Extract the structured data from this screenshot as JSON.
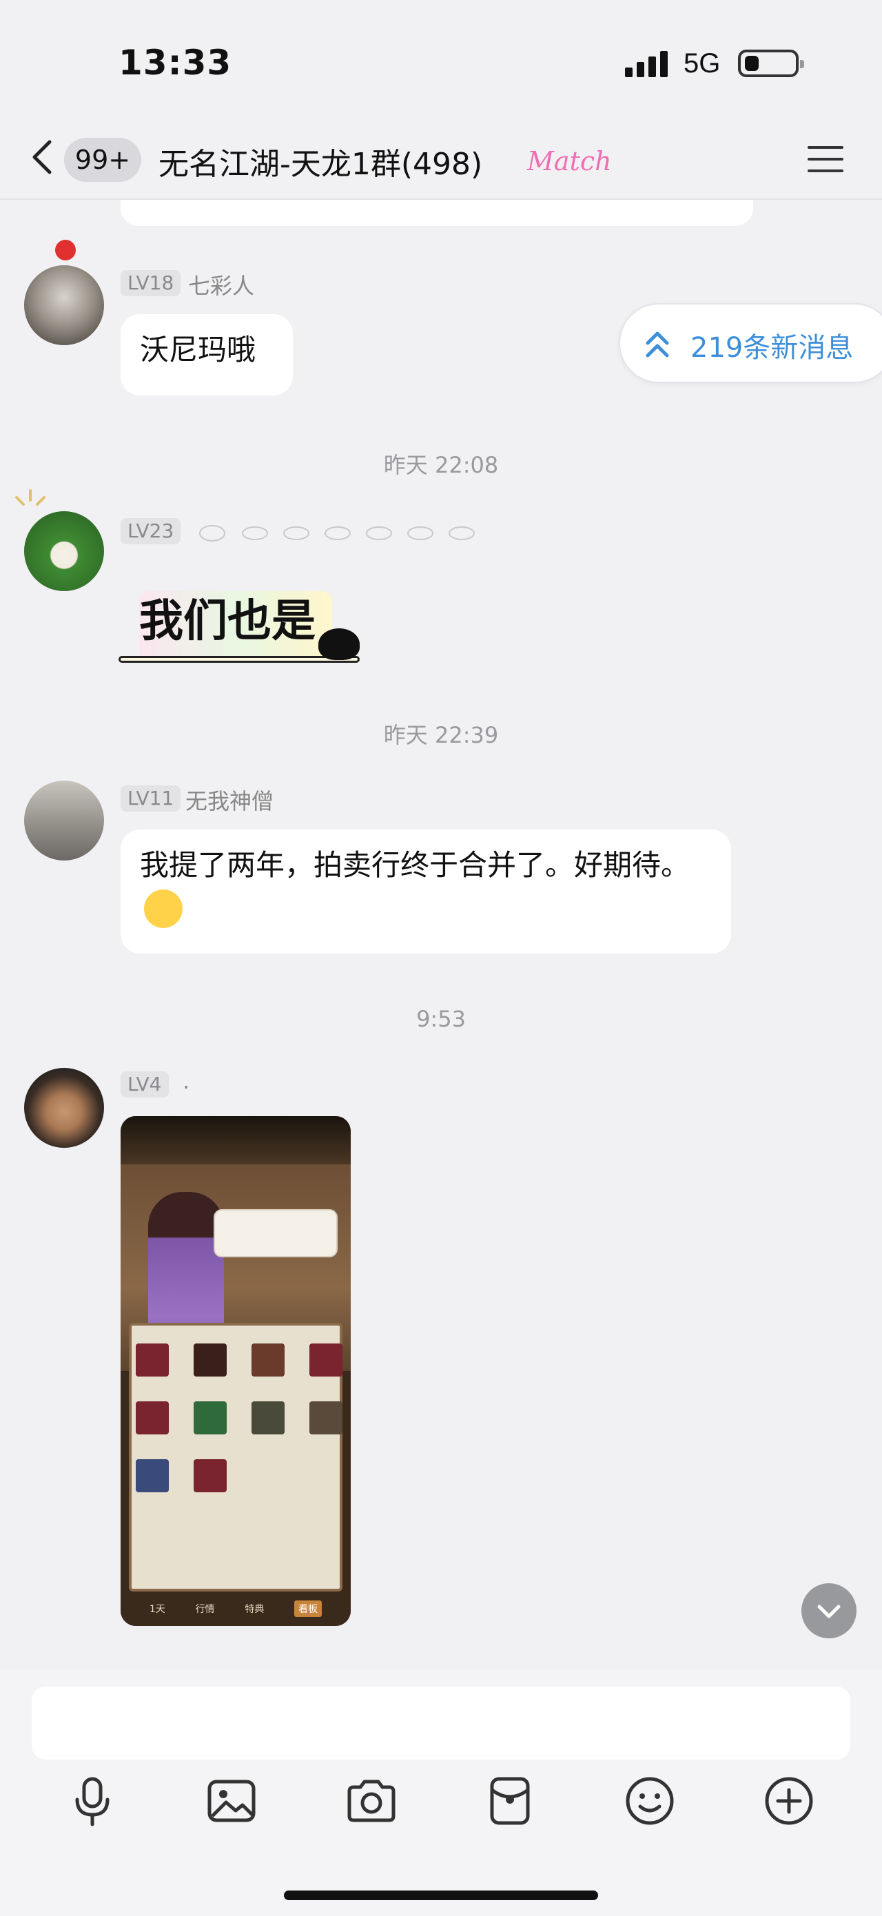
{
  "status_bar": {
    "time": "13:33",
    "network": "5G"
  },
  "header": {
    "unread_badge": "99+",
    "title": "无名江湖-天龙1群(498)",
    "title_tag": "Match"
  },
  "new_messages": {
    "label": "219条新消息"
  },
  "messages": [
    {
      "level": "LV18",
      "nickname": "七彩人",
      "text": "沃尼玛哦"
    },
    {
      "timestamp": "昨天 22:08"
    },
    {
      "level": "LV23",
      "nickname": "",
      "sticker_text": "我们也是"
    },
    {
      "timestamp": "昨天 22:39"
    },
    {
      "level": "LV11",
      "nickname": "无我神僧",
      "text": "我提了两年，拍卖行终于合并了。好期待。"
    },
    {
      "timestamp": "9:53"
    },
    {
      "level": "LV4",
      "nickname": ".",
      "image_description": "game-auction-screenshot"
    }
  ],
  "image_tabs": [
    "1天",
    "行情",
    "特典",
    "看板"
  ],
  "toolbar": {
    "icons": [
      "microphone-icon",
      "image-icon",
      "camera-icon",
      "red-packet-icon",
      "emoji-icon",
      "plus-icon"
    ]
  },
  "colors": {
    "accent_blue": "#3d8fd9",
    "tag_pink": "#f06db4",
    "bubble": "#ffffff",
    "background": "#f1f1f3"
  }
}
